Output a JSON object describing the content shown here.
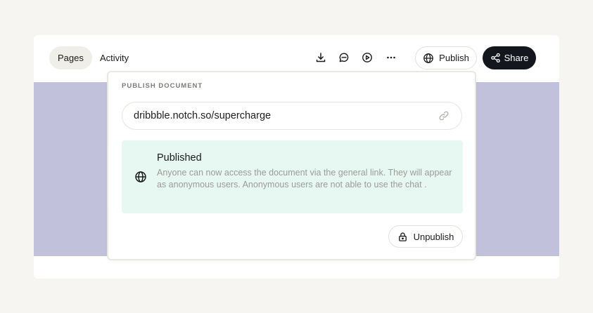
{
  "header": {
    "tabs": [
      {
        "label": "Pages",
        "active": true
      },
      {
        "label": "Activity",
        "active": false
      }
    ],
    "toolbar_icons": [
      "download-icon",
      "comment-icon",
      "play-icon",
      "more-icon"
    ],
    "publish_label": "Publish",
    "share_label": "Share"
  },
  "popover": {
    "title": "PUBLISH DOCUMENT",
    "url": "dribbble.notch.so/supercharge",
    "status": {
      "title": "Published",
      "description": "Anyone can now access the document via the general link. They will appear as anonymous users. Anonymous users are not able to use the chat ."
    },
    "unpublish_label": "Unpublish"
  },
  "colors": {
    "background": "#f6f5f2",
    "canvas_purple": "#c2c1dc",
    "share_button": "#13161d",
    "status_bg": "#e6f8f1"
  }
}
